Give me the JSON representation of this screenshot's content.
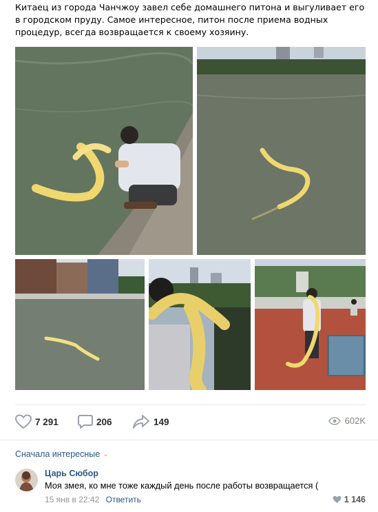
{
  "post": {
    "text": "Китаец из города Чанчжоу завел себе домашнего питона и выгуливает его в городском пруду. Самое интересное, питон после приема водных процедур, всегда возвращается к своему хозяину.",
    "photos": [
      "photo-1",
      "photo-2",
      "photo-3",
      "photo-4",
      "photo-5"
    ]
  },
  "actions": {
    "likes": "7 291",
    "comments": "206",
    "shares": "149",
    "views": "602K"
  },
  "icons": {
    "like": "heart-icon",
    "comment": "comment-icon",
    "share": "share-icon",
    "views": "eye-icon"
  },
  "comments": {
    "sort_label": "Сначала интересные",
    "items": [
      {
        "author": "Царь Сюбор",
        "text": "Моя змея, ко мне тоже каждый день после работы возвращается (",
        "date": "15 янв в 22:42",
        "reply_label": "Ответить",
        "likes": "1 146"
      }
    ]
  },
  "colors": {
    "link": "#2a5885",
    "meta": "#939393",
    "icon": "#99a2ad",
    "separator": "#e7e8ec"
  }
}
